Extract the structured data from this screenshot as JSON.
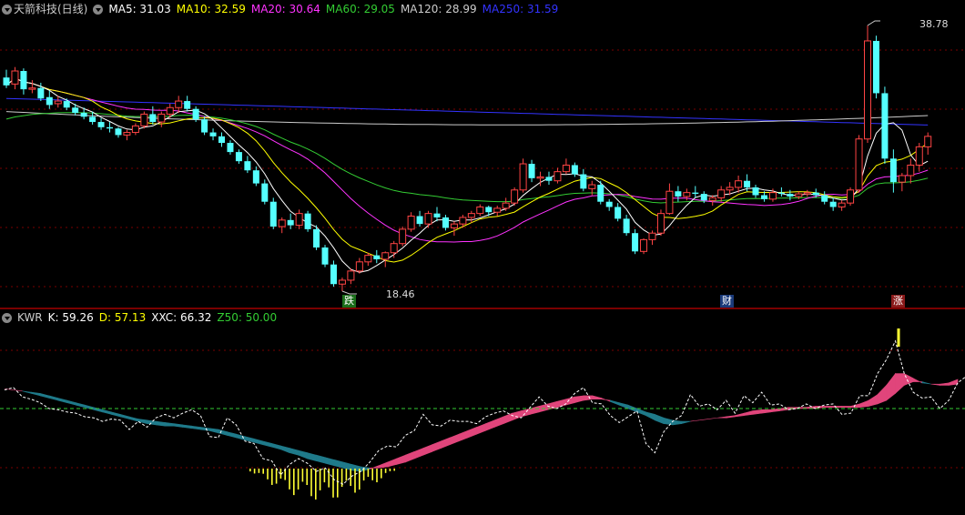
{
  "header": {
    "title": "天箭科技(日线)",
    "ma": [
      {
        "label": "MA5: 31.03",
        "color": "#ffffff"
      },
      {
        "label": "MA10: 32.59",
        "color": "#ffff00"
      },
      {
        "label": "MA20: 30.64",
        "color": "#ff33ff"
      },
      {
        "label": "MA60: 29.05",
        "color": "#33cc33"
      },
      {
        "label": "MA120: 28.99",
        "color": "#cccccc"
      },
      {
        "label": "MA250: 31.59",
        "color": "#3333ff"
      }
    ]
  },
  "lower_header": {
    "name": "KWR",
    "items": [
      {
        "label": "K: 59.26",
        "color": "#ffffff"
      },
      {
        "label": "D: 57.13",
        "color": "#ffff00"
      },
      {
        "label": "XXC: 66.32",
        "color": "#ffffff"
      },
      {
        "label": "Z50: 50.00",
        "color": "#33cc33"
      }
    ]
  },
  "annotations": {
    "high_label": "38.78",
    "low_label": "18.46",
    "markers": [
      {
        "text": "跌",
        "bg": "#1a6e1a",
        "color": "#ffffff"
      },
      {
        "text": "财",
        "bg": "#1a3a7a",
        "color": "#ffffff"
      },
      {
        "text": "涨",
        "bg": "#8a1a1a",
        "color": "#ffffff"
      }
    ]
  },
  "colors": {
    "up": "#ff4444",
    "down": "#55ffff",
    "grid": "#7a0000",
    "band_up": "#e0457b",
    "band_down": "#1f7a8a",
    "hist": "#ffff33"
  },
  "chart_data": [
    {
      "type": "candlestick",
      "title": "天箭科技(日线)",
      "ylim": [
        17.0,
        40.5
      ],
      "y_anchors": [
        [
          38.78,
          28
        ],
        [
          18.46,
          320
        ]
      ],
      "candles": [
        [
          34.8,
          35.4,
          34.0,
          34.2
        ],
        [
          34.3,
          35.6,
          33.9,
          35.3
        ],
        [
          35.3,
          35.5,
          33.5,
          33.9
        ],
        [
          33.9,
          34.6,
          33.6,
          34.0
        ],
        [
          34.0,
          34.4,
          33.0,
          33.2
        ],
        [
          33.3,
          33.8,
          32.4,
          32.7
        ],
        [
          32.8,
          33.4,
          32.5,
          33.0
        ],
        [
          33.0,
          33.2,
          32.3,
          32.5
        ],
        [
          32.5,
          32.8,
          31.9,
          32.1
        ],
        [
          32.1,
          32.5,
          31.6,
          31.8
        ],
        [
          31.8,
          32.2,
          31.2,
          31.4
        ],
        [
          31.4,
          31.7,
          30.8,
          31.0
        ],
        [
          31.0,
          31.4,
          30.6,
          30.9
        ],
        [
          30.9,
          31.0,
          30.2,
          30.4
        ],
        [
          30.4,
          30.8,
          30.0,
          30.6
        ],
        [
          30.6,
          31.3,
          30.4,
          31.1
        ],
        [
          31.1,
          32.2,
          30.9,
          32.0
        ],
        [
          32.0,
          32.6,
          31.2,
          31.4
        ],
        [
          31.4,
          32.2,
          31.0,
          32.0
        ],
        [
          32.0,
          32.8,
          31.7,
          32.5
        ],
        [
          32.5,
          33.4,
          32.1,
          33.0
        ],
        [
          33.0,
          33.4,
          32.2,
          32.4
        ],
        [
          32.4,
          32.6,
          31.4,
          31.6
        ],
        [
          31.6,
          31.8,
          30.4,
          30.6
        ],
        [
          30.6,
          30.9,
          30.0,
          30.3
        ],
        [
          30.3,
          30.6,
          29.5,
          29.8
        ],
        [
          29.8,
          30.0,
          28.9,
          29.1
        ],
        [
          29.1,
          29.3,
          28.2,
          28.4
        ],
        [
          28.4,
          28.8,
          27.5,
          27.7
        ],
        [
          27.7,
          28.0,
          26.5,
          26.7
        ],
        [
          26.7,
          27.0,
          25.1,
          25.3
        ],
        [
          25.3,
          25.6,
          23.2,
          23.4
        ],
        [
          23.4,
          24.1,
          22.9,
          23.9
        ],
        [
          23.9,
          24.4,
          23.2,
          23.5
        ],
        [
          23.5,
          24.7,
          23.2,
          24.4
        ],
        [
          24.4,
          24.6,
          23.0,
          23.2
        ],
        [
          23.2,
          23.5,
          21.6,
          21.8
        ],
        [
          21.8,
          22.0,
          20.3,
          20.5
        ],
        [
          20.5,
          20.8,
          18.8,
          19.0
        ],
        [
          19.0,
          19.5,
          18.46,
          19.3
        ],
        [
          19.3,
          20.2,
          19.0,
          20.0
        ],
        [
          20.0,
          21.0,
          19.8,
          20.7
        ],
        [
          20.7,
          21.4,
          20.4,
          21.2
        ],
        [
          21.2,
          21.6,
          20.6,
          20.9
        ],
        [
          20.9,
          21.5,
          20.3,
          21.4
        ],
        [
          21.4,
          22.3,
          21.0,
          22.1
        ],
        [
          22.1,
          23.4,
          21.9,
          23.2
        ],
        [
          23.2,
          24.5,
          23.0,
          24.2
        ],
        [
          24.2,
          24.6,
          23.4,
          23.6
        ],
        [
          23.6,
          24.6,
          23.3,
          24.4
        ],
        [
          24.4,
          24.9,
          23.8,
          24.1
        ],
        [
          24.1,
          24.3,
          23.1,
          23.3
        ],
        [
          23.3,
          23.8,
          22.7,
          23.6
        ],
        [
          23.6,
          24.3,
          23.3,
          24.1
        ],
        [
          24.1,
          24.6,
          23.7,
          24.4
        ],
        [
          24.4,
          25.1,
          24.2,
          24.9
        ],
        [
          24.9,
          25.0,
          24.2,
          24.5
        ],
        [
          24.5,
          25.0,
          24.2,
          24.8
        ],
        [
          24.8,
          25.6,
          24.6,
          25.2
        ],
        [
          25.2,
          26.4,
          25.0,
          26.2
        ],
        [
          26.2,
          28.6,
          26.0,
          28.2
        ],
        [
          28.2,
          28.5,
          26.8,
          27.1
        ],
        [
          27.1,
          27.6,
          26.5,
          27.2
        ],
        [
          27.2,
          27.6,
          26.6,
          26.9
        ],
        [
          26.9,
          27.9,
          26.7,
          27.6
        ],
        [
          27.6,
          28.6,
          27.4,
          28.1
        ],
        [
          28.1,
          28.3,
          27.2,
          27.4
        ],
        [
          27.4,
          27.8,
          26.1,
          26.3
        ],
        [
          26.3,
          26.9,
          25.8,
          26.6
        ],
        [
          26.6,
          26.9,
          25.1,
          25.3
        ],
        [
          25.3,
          25.5,
          24.6,
          24.9
        ],
        [
          24.9,
          25.2,
          23.8,
          24.0
        ],
        [
          24.0,
          24.3,
          22.7,
          22.9
        ],
        [
          22.9,
          23.2,
          21.3,
          21.5
        ],
        [
          21.5,
          22.5,
          21.3,
          22.4
        ],
        [
          22.4,
          23.1,
          22.0,
          22.9
        ],
        [
          22.9,
          24.7,
          22.7,
          24.4
        ],
        [
          24.4,
          26.7,
          24.3,
          26.1
        ],
        [
          26.1,
          26.5,
          25.3,
          25.7
        ],
        [
          25.7,
          26.3,
          25.4,
          26.0
        ],
        [
          26.0,
          26.5,
          25.6,
          25.9
        ],
        [
          25.9,
          26.1,
          25.2,
          25.4
        ],
        [
          25.4,
          25.8,
          25.0,
          25.6
        ],
        [
          25.6,
          26.5,
          25.3,
          26.2
        ],
        [
          26.2,
          26.8,
          25.8,
          26.4
        ],
        [
          26.4,
          27.3,
          26.0,
          26.9
        ],
        [
          26.9,
          27.4,
          26.1,
          26.4
        ],
        [
          26.4,
          26.6,
          25.6,
          25.8
        ],
        [
          25.8,
          26.1,
          25.3,
          25.5
        ],
        [
          25.5,
          26.3,
          25.3,
          26.0
        ],
        [
          26.0,
          26.4,
          25.7,
          25.9
        ],
        [
          25.9,
          26.2,
          25.4,
          25.7
        ],
        [
          25.7,
          26.1,
          25.5,
          25.9
        ],
        [
          25.9,
          26.2,
          25.7,
          26.0
        ],
        [
          26.0,
          26.3,
          25.6,
          25.8
        ],
        [
          25.8,
          26.1,
          25.1,
          25.3
        ],
        [
          25.3,
          25.6,
          24.6,
          24.9
        ],
        [
          24.9,
          25.4,
          24.6,
          25.2
        ],
        [
          25.2,
          26.4,
          25.0,
          26.2
        ],
        [
          26.2,
          30.4,
          26.0,
          30.1
        ],
        [
          30.1,
          38.78,
          29.8,
          37.6
        ],
        [
          37.6,
          38.0,
          33.2,
          33.6
        ],
        [
          33.6,
          34.1,
          28.2,
          28.6
        ],
        [
          28.6,
          29.3,
          26.0,
          26.8
        ],
        [
          26.8,
          27.5,
          26.1,
          27.3
        ],
        [
          27.3,
          28.6,
          26.7,
          28.1
        ],
        [
          28.1,
          29.8,
          27.6,
          29.5
        ],
        [
          29.5,
          30.6,
          28.9,
          30.3
        ]
      ]
    },
    {
      "type": "line",
      "title": "KWR",
      "ylim": [
        -30,
        112
      ],
      "series": [
        {
          "name": "K",
          "values": [
            67,
            66,
            65,
            63,
            61,
            59,
            57,
            55,
            53,
            51,
            49,
            47,
            45,
            43,
            41,
            39,
            37,
            36,
            35,
            35,
            34,
            33,
            32,
            31,
            29,
            27,
            25,
            23,
            21,
            19,
            17,
            15,
            12,
            10,
            7,
            5,
            3,
            1,
            -1,
            -3,
            -4,
            -2,
            1,
            4,
            7,
            10,
            13,
            16,
            19,
            22,
            25,
            28,
            31,
            34,
            37,
            40,
            43,
            46,
            48,
            50,
            52,
            54,
            56,
            58,
            60,
            61,
            61,
            59,
            56,
            53,
            50,
            47,
            44,
            40,
            37,
            36,
            37,
            39,
            40,
            41,
            42,
            43,
            44,
            46,
            48,
            49,
            49,
            50,
            51,
            51,
            51,
            52,
            52,
            52,
            52,
            52,
            54,
            57,
            62,
            70,
            80,
            80,
            76,
            72,
            71,
            71,
            72,
            75
          ]
        },
        {
          "name": "D",
          "values": [
            67,
            66,
            65,
            64,
            63,
            61,
            59,
            57,
            55,
            53,
            51,
            49,
            47,
            45,
            43,
            41,
            40,
            39,
            38,
            37,
            36,
            35,
            34,
            33,
            32,
            30,
            28,
            26,
            24,
            22,
            20,
            18,
            16,
            14,
            12,
            10,
            8,
            6,
            4,
            2,
            0,
            -1,
            -1,
            0,
            2,
            4,
            7,
            10,
            13,
            16,
            19,
            22,
            25,
            28,
            31,
            34,
            37,
            40,
            43,
            45,
            47,
            49,
            51,
            53,
            55,
            57,
            58,
            58,
            57,
            55,
            53,
            50,
            47,
            45,
            42,
            40,
            39,
            39,
            40,
            41,
            42,
            42,
            43,
            44,
            45,
            46,
            47,
            48,
            49,
            50,
            50,
            50,
            51,
            51,
            51,
            51,
            51,
            52,
            54,
            57,
            63,
            70,
            73,
            73,
            71,
            70,
            70,
            71,
            72
          ]
        },
        {
          "name": "XXC",
          "values": [
            66,
            68,
            60,
            58,
            55,
            50,
            49,
            47,
            46,
            43,
            42,
            39,
            41,
            40,
            32,
            39,
            34,
            42,
            45,
            42,
            46,
            49,
            44,
            26,
            25,
            42,
            36,
            22,
            20,
            7,
            5,
            -7,
            2,
            7,
            3,
            -4,
            -1,
            -11,
            -15,
            -8,
            -4,
            4,
            14,
            18,
            17,
            27,
            31,
            45,
            36,
            35,
            40,
            39,
            39,
            37,
            43,
            46,
            48,
            44,
            42,
            51,
            60,
            52,
            50,
            54,
            63,
            68,
            55,
            54,
            44,
            38,
            43,
            48,
            20,
            12,
            30,
            39,
            44,
            62,
            52,
            54,
            49,
            57,
            46,
            61,
            55,
            64,
            53,
            54,
            49,
            50,
            54,
            50,
            53,
            54,
            45,
            46,
            61,
            61,
            80,
            92,
            108,
            80,
            64,
            59,
            60,
            50,
            57,
            72,
            78
          ]
        },
        {
          "name": "Z50",
          "values": [
            50
          ]
        }
      ],
      "histogram": [
        {
          "x": 65,
          "values": [
            5,
            -3,
            -12,
            -15,
            -10,
            0,
            -9,
            -6,
            -4,
            -20,
            -28,
            -25,
            -22,
            -15,
            -10,
            -14,
            -14,
            -12,
            -10,
            -8,
            -6,
            -6,
            -4,
            -3,
            -2
          ]
        }
      ]
    }
  ]
}
